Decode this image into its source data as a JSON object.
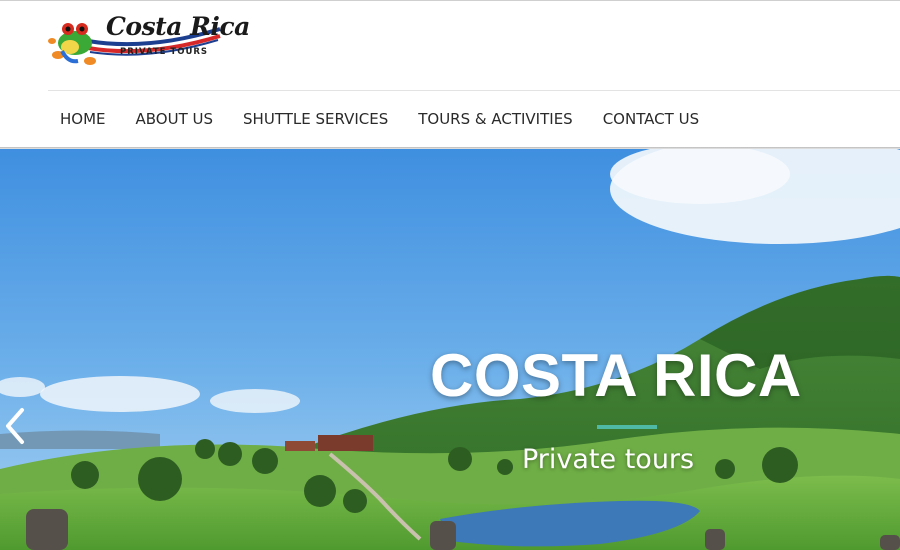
{
  "logo": {
    "title": "Costa Rica",
    "subtitle": "PRIVATE TOURS",
    "icon": "tree-frog-icon"
  },
  "nav": {
    "items": [
      {
        "label": "HOME"
      },
      {
        "label": "ABOUT US"
      },
      {
        "label": "SHUTTLE SERVICES"
      },
      {
        "label": "TOURS & ACTIVITIES"
      },
      {
        "label": "CONTACT US"
      }
    ]
  },
  "hero": {
    "title": "COSTA RICA",
    "subtitle": "Private tours",
    "prev_icon": "chevron-left-icon",
    "accent_color": "#4fb9a6"
  }
}
